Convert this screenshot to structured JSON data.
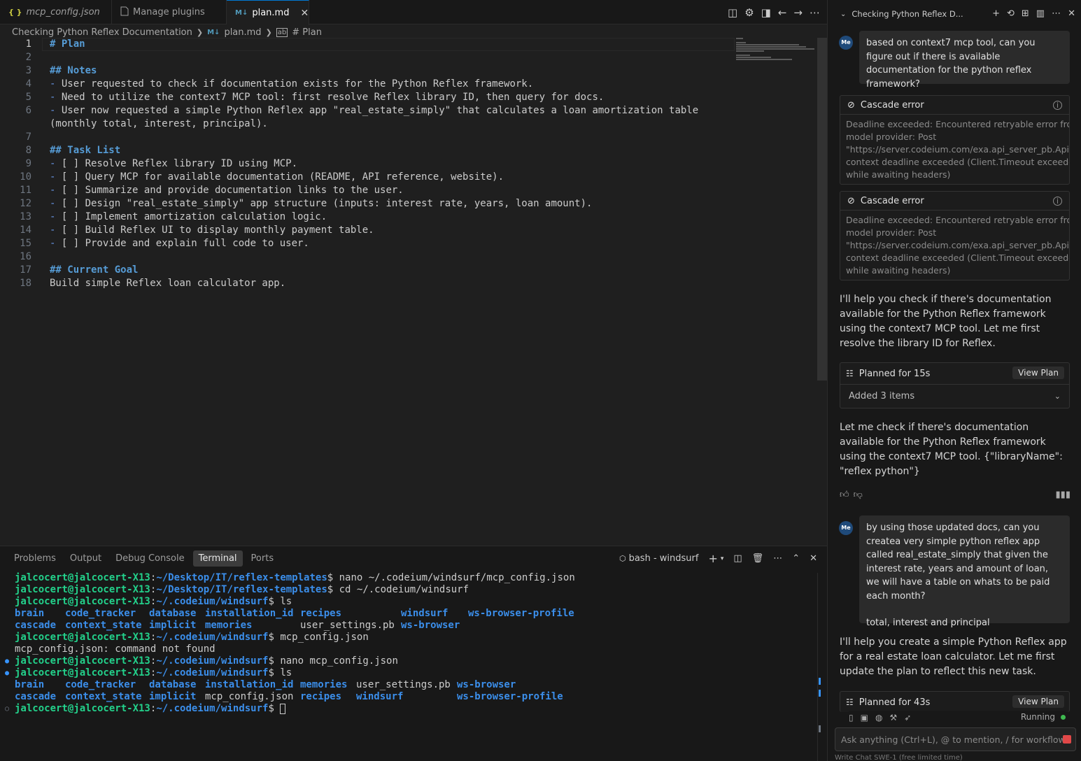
{
  "tabs": [
    {
      "label": "mcp_config.json",
      "icon": "json-icon",
      "active": false
    },
    {
      "label": "Manage plugins",
      "icon": "file-icon",
      "active": false
    },
    {
      "label": "plan.md",
      "icon": "markdown-icon",
      "active": true
    }
  ],
  "breadcrumb": {
    "folder": "Checking Python Reflex Documentation",
    "file": "plan.md",
    "symbol": "# Plan"
  },
  "editor": {
    "lines": [
      {
        "n": "1",
        "text": "# Plan",
        "kind": "h"
      },
      {
        "n": "2",
        "text": "",
        "kind": "t"
      },
      {
        "n": "3",
        "text": "## Notes",
        "kind": "h"
      },
      {
        "n": "4",
        "text": "User requested to check if documentation exists for the Python Reflex framework.",
        "kind": "li"
      },
      {
        "n": "5",
        "text": "Need to utilize the context7 MCP tool: first resolve Reflex library ID, then query for docs.",
        "kind": "li"
      },
      {
        "n": "6",
        "text": "User now requested a simple Python Reflex app \"real_estate_simply\" that calculates a loan amortization table",
        "kind": "li"
      },
      {
        "n": "",
        "text": "(monthly total, interest, principal).",
        "kind": "t"
      },
      {
        "n": "7",
        "text": "",
        "kind": "t"
      },
      {
        "n": "8",
        "text": "## Task List",
        "kind": "h"
      },
      {
        "n": "9",
        "text": "[ ] Resolve Reflex library ID using MCP.",
        "kind": "li"
      },
      {
        "n": "10",
        "text": "[ ] Query MCP for available documentation (README, API reference, website).",
        "kind": "li"
      },
      {
        "n": "11",
        "text": "[ ] Summarize and provide documentation links to the user.",
        "kind": "li"
      },
      {
        "n": "12",
        "text": "[ ] Design \"real_estate_simply\" app structure (inputs: interest rate, years, loan amount).",
        "kind": "li"
      },
      {
        "n": "13",
        "text": "[ ] Implement amortization calculation logic.",
        "kind": "li"
      },
      {
        "n": "14",
        "text": "[ ] Build Reflex UI to display monthly payment table.",
        "kind": "li"
      },
      {
        "n": "15",
        "text": "[ ] Provide and explain full code to user.",
        "kind": "li"
      },
      {
        "n": "16",
        "text": "",
        "kind": "t"
      },
      {
        "n": "17",
        "text": "## Current Goal",
        "kind": "h"
      },
      {
        "n": "18",
        "text": "Build simple Reflex loan calculator app.",
        "kind": "t"
      }
    ]
  },
  "panel": {
    "tabs": [
      "Problems",
      "Output",
      "Debug Console",
      "Terminal",
      "Ports"
    ],
    "active_tab": "Terminal",
    "terminal_name": "bash - windsurf"
  },
  "terminal": {
    "user": "jalcocert@jalcocert-X13",
    "lines": [
      {
        "type": "cmd",
        "path": "~/Desktop/IT/reflex-templates",
        "cmd": "nano ~/.codeium/windsurf/mcp_config.json",
        "dot": ""
      },
      {
        "type": "cmd",
        "path": "~/Desktop/IT/reflex-templates",
        "cmd": "cd ~/.codeium/windsurf",
        "dot": ""
      },
      {
        "type": "cmd",
        "path": "~/.codeium/windsurf",
        "cmd": "ls",
        "dot": ""
      },
      {
        "type": "ls",
        "items": [
          [
            "brain",
            "d",
            9
          ],
          [
            "code_tracker",
            "d",
            15
          ],
          [
            "database",
            "d",
            10
          ],
          [
            "installation_id",
            "d",
            17
          ],
          [
            "recipes",
            "d",
            18
          ],
          [
            "windsurf",
            "d",
            12
          ],
          [
            "ws-browser-profile",
            "d",
            0
          ]
        ]
      },
      {
        "type": "ls",
        "items": [
          [
            "cascade",
            "d",
            9
          ],
          [
            "context_state",
            "d",
            15
          ],
          [
            "implicit",
            "d",
            10
          ],
          [
            "memories",
            "d",
            17
          ],
          [
            "user_settings.pb",
            "f",
            18
          ],
          [
            "ws-browser",
            "d",
            0
          ]
        ]
      },
      {
        "type": "cmd",
        "path": "~/.codeium/windsurf",
        "cmd": "mcp_config.json",
        "dot": ""
      },
      {
        "type": "out",
        "text": "mcp_config.json: command not found"
      },
      {
        "type": "cmd",
        "path": "~/.codeium/windsurf",
        "cmd": "nano mcp_config.json",
        "dot": "filled"
      },
      {
        "type": "cmd",
        "path": "~/.codeium/windsurf",
        "cmd": "ls",
        "dot": "filled"
      },
      {
        "type": "ls",
        "items": [
          [
            "brain",
            "d",
            9
          ],
          [
            "code_tracker",
            "d",
            15
          ],
          [
            "database",
            "d",
            10
          ],
          [
            "installation_id",
            "d",
            17
          ],
          [
            "memories",
            "d",
            10
          ],
          [
            "user_settings.pb",
            "f",
            18
          ],
          [
            "ws-browser",
            "d",
            0
          ]
        ]
      },
      {
        "type": "ls",
        "items": [
          [
            "cascade",
            "d",
            9
          ],
          [
            "context_state",
            "d",
            15
          ],
          [
            "implicit",
            "d",
            10
          ],
          [
            "mcp_config.json",
            "f",
            17
          ],
          [
            "recipes",
            "d",
            10
          ],
          [
            "windsurf",
            "d",
            18
          ],
          [
            "ws-browser-profile",
            "d",
            0
          ]
        ]
      },
      {
        "type": "prompt",
        "path": "~/.codeium/windsurf",
        "dot": "hollow"
      }
    ]
  },
  "chat": {
    "title": "Checking Python Reflex D...",
    "user_initials": "Me",
    "msg1": "based on context7 mcp tool, can you figure out if there is available documentation for the python reflex framework?",
    "errors": [
      {
        "title": "Cascade error",
        "lines": [
          "Deadline exceeded: Encountered retryable error from",
          "model provider: Post",
          "\"https://server.codeium.com/exa.api_server_pb.ApiSer",
          "context deadline exceeded (Client.Timeout exceeded",
          "while awaiting headers)"
        ]
      },
      {
        "title": "Cascade error",
        "lines": [
          "Deadline exceeded: Encountered retryable error from",
          "model provider: Post",
          "\"https://server.codeium.com/exa.api_server_pb.ApiSer",
          "context deadline exceeded (Client.Timeout exceeded",
          "while awaiting headers)"
        ]
      }
    ],
    "ai1": "I'll help you check if there's documentation available for the Python Reflex framework using the context7 MCP tool. Let me first resolve the library ID for Reflex.",
    "plan1": {
      "title": "Planned for 15s",
      "button": "View Plan",
      "sub": "Added 3 items"
    },
    "ai2": "Let me check if there's documentation available for the Python Reflex framework using the context7 MCP tool. {\"libraryName\": \"reflex python\"}",
    "msg2_lines": [
      "by using those updated docs, can you createa very simple python reflex app called real_estate_simply that given the interest rate, years and amount of loan, we will have a table on whats to be paid each month?",
      "",
      "total, interest and principal"
    ],
    "ai3": "I'll help you create a simple Python Reflex app for a real estate loan calculator. Let me first update the plan to reflect this new task.",
    "plan2": {
      "title": "Planned for 43s",
      "button": "View Plan"
    },
    "status": "Running",
    "input_placeholder": "Ask anything (Ctrl+L), @ to mention, / for workflows",
    "footer": "Write   Chat   SWE-1 (free limited time)"
  }
}
